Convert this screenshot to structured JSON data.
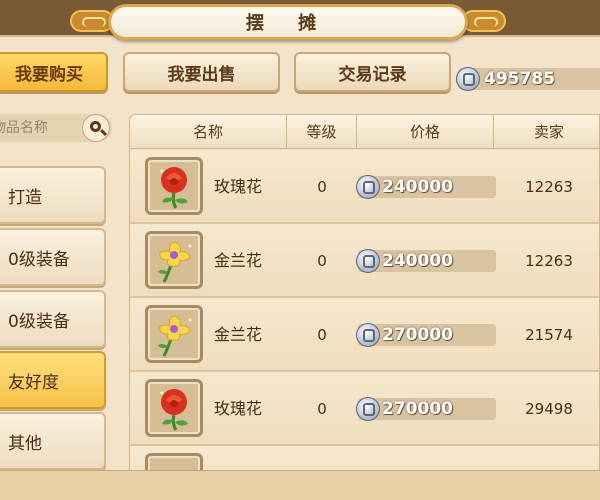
{
  "header": {
    "title": "摆 摊"
  },
  "tabs": [
    {
      "label": "我要购买",
      "active": true
    },
    {
      "label": "我要出售",
      "active": false
    },
    {
      "label": "交易记录",
      "active": false
    }
  ],
  "balance": {
    "icon": "silver-coin-icon",
    "value": "495785"
  },
  "search": {
    "placeholder": "物品名称",
    "icon": "search-icon"
  },
  "categories": [
    {
      "label": "打造",
      "active": false
    },
    {
      "label": "0级装备",
      "active": false
    },
    {
      "label": "0级装备",
      "active": false
    },
    {
      "label": "友好度",
      "active": true
    },
    {
      "label": "其他",
      "active": false
    }
  ],
  "table": {
    "columns": [
      "名称",
      "等级",
      "价格",
      "卖家"
    ],
    "rows": [
      {
        "icon": "rose-icon",
        "name": "玫瑰花",
        "level": "0",
        "price": "240000",
        "seller": "12263"
      },
      {
        "icon": "orchid-icon",
        "name": "金兰花",
        "level": "0",
        "price": "240000",
        "seller": "12263"
      },
      {
        "icon": "orchid-icon",
        "name": "金兰花",
        "level": "0",
        "price": "270000",
        "seller": "21574"
      },
      {
        "icon": "rose-icon",
        "name": "玫瑰花",
        "level": "0",
        "price": "270000",
        "seller": "29498"
      }
    ]
  },
  "colors": {
    "active_tab": "#f4b93a",
    "panel": "#f3e3c8",
    "text": "#4a2e14"
  }
}
